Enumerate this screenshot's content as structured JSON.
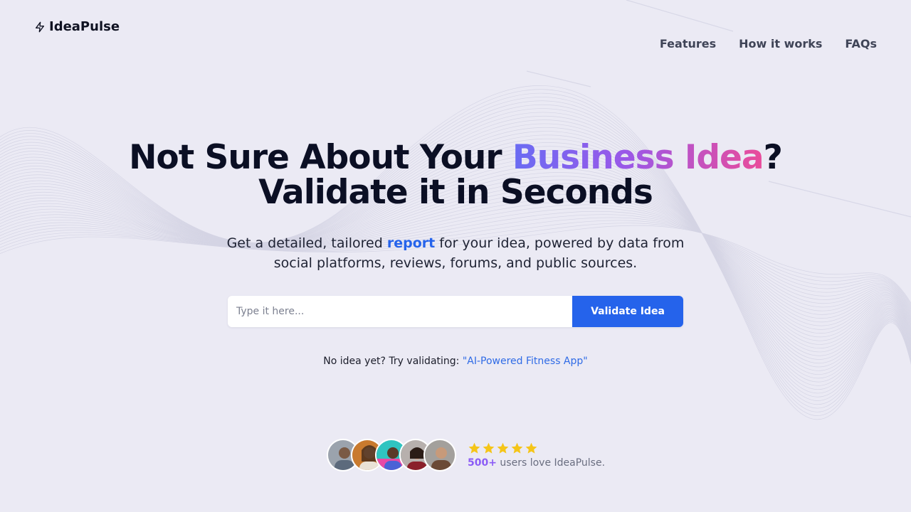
{
  "brand": {
    "name": "IdeaPulse",
    "icon": "bolt-icon"
  },
  "nav": [
    {
      "label": "Features"
    },
    {
      "label": "How it works"
    },
    {
      "label": "FAQs"
    }
  ],
  "hero": {
    "line1_a": "Not Sure About Your ",
    "line1_highlight": "Business Idea",
    "line1_b": "?",
    "line2": "Validate it in Seconds"
  },
  "subtitle": {
    "part1": "Get a detailed, tailored ",
    "highlight": "report",
    "part2": " for your idea, powered by data from",
    "line2": "social platforms, reviews, forums, and public sources."
  },
  "search": {
    "placeholder": "Type it here...",
    "value": "",
    "button_label": "Validate Idea"
  },
  "suggestion": {
    "prefix": "No idea yet? Try validating: ",
    "link": "\"AI-Powered Fitness App\""
  },
  "social_proof": {
    "stars": 5,
    "count": "500+",
    "text": " users love IdeaPulse.",
    "star_color": "#f5c518"
  },
  "colors": {
    "accent": "#2563eb",
    "gradient_start": "#6a6cf3",
    "gradient_end": "#ea4c9a",
    "background": "#ebeaf4"
  }
}
